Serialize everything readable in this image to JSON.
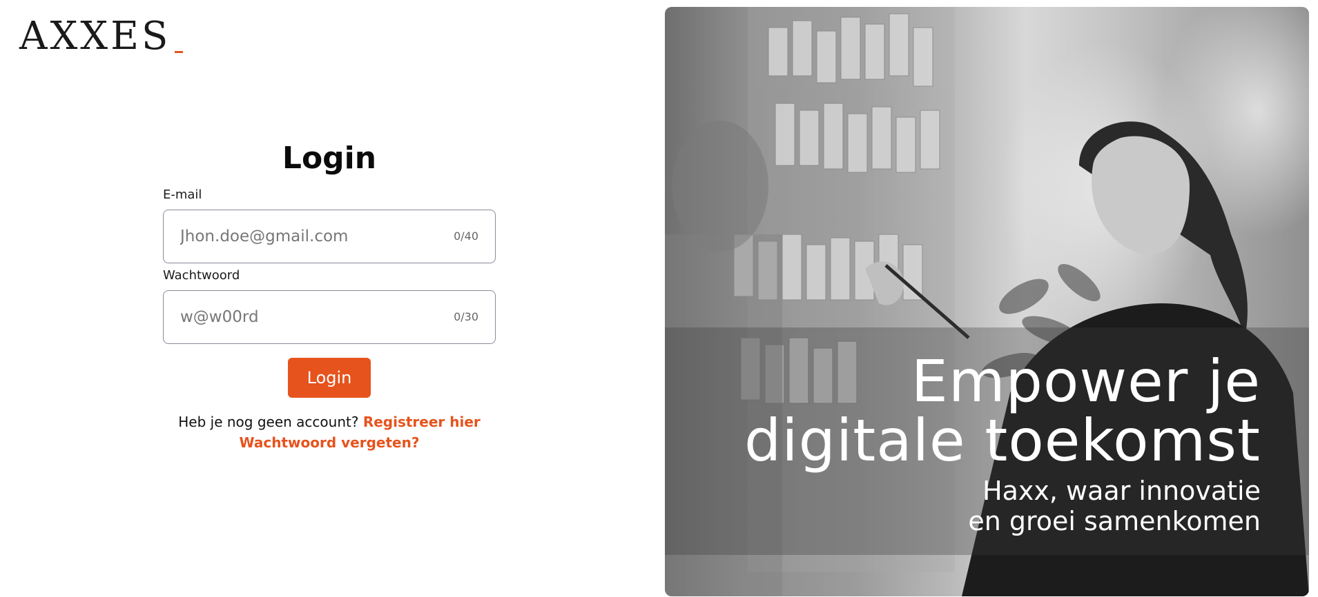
{
  "logo": {
    "text": "AXXES",
    "accent_color": "#e6531d"
  },
  "login": {
    "title": "Login",
    "email": {
      "label": "E-mail",
      "placeholder": "Jhon.doe@gmail.com",
      "value": "",
      "counter": "0/40"
    },
    "password": {
      "label": "Wachtwoord",
      "placeholder": "w@w00rd",
      "value": "",
      "counter": "0/30"
    },
    "submit_label": "Login",
    "no_account_text": "Heb je nog geen account?",
    "register_link": "Registreer hier",
    "forgot_link": "Wachtwoord vergeten?"
  },
  "hero": {
    "headline_line1": "Empower je",
    "headline_line2": "digitale toekomst",
    "subline_line1": "Haxx, waar innovatie",
    "subline_line2": "en groei samenkomen"
  },
  "colors": {
    "accent": "#e6531d",
    "text": "#111111",
    "border": "#8a8a9a"
  }
}
